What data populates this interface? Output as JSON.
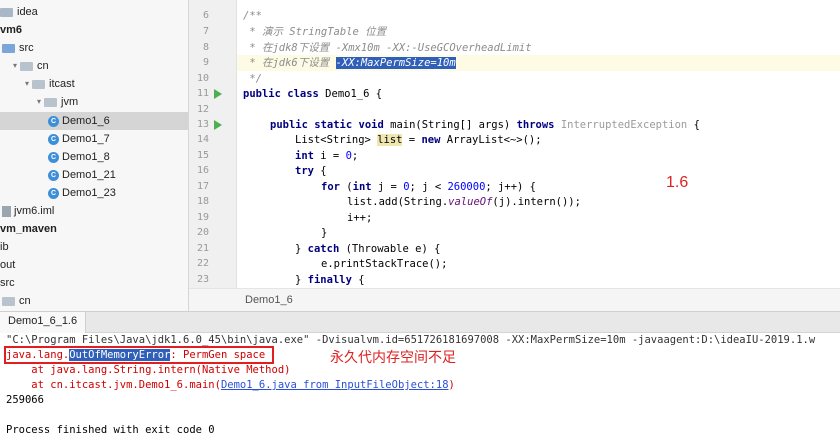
{
  "tree": [
    {
      "label": "idea",
      "arrow": "",
      "icon": "folder",
      "bold": false
    },
    {
      "label": "vm6",
      "arrow": "",
      "icon": "",
      "bold": true
    },
    {
      "label": "src",
      "arrow": "",
      "icon": "src",
      "bold": false
    },
    {
      "label": "cn",
      "arrow": "▾",
      "icon": "pkg",
      "bold": false
    },
    {
      "label": "itcast",
      "arrow": "▾",
      "icon": "pkg",
      "bold": false
    },
    {
      "label": "jvm",
      "arrow": "▾",
      "icon": "pkg",
      "bold": false
    },
    {
      "label": "Demo1_6",
      "arrow": "",
      "icon": "class",
      "bold": false,
      "selected": true
    },
    {
      "label": "Demo1_7",
      "arrow": "",
      "icon": "class",
      "bold": false
    },
    {
      "label": "Demo1_8",
      "arrow": "",
      "icon": "class",
      "bold": false
    },
    {
      "label": "Demo1_21",
      "arrow": "",
      "icon": "class",
      "bold": false
    },
    {
      "label": "Demo1_23",
      "arrow": "",
      "icon": "class",
      "bold": false
    },
    {
      "label": "jvm6.iml",
      "arrow": "",
      "icon": "file",
      "bold": false
    },
    {
      "label": "vm_maven",
      "arrow": "",
      "icon": "",
      "bold": true
    },
    {
      "label": "ib",
      "arrow": "",
      "icon": "",
      "bold": false
    },
    {
      "label": "out",
      "arrow": "",
      "icon": "",
      "bold": false
    },
    {
      "label": "src",
      "arrow": "",
      "icon": "",
      "bold": false
    },
    {
      "label": "cn",
      "arrow": "",
      "icon": "pkg",
      "bold": false
    }
  ],
  "line_numbers": [
    "6",
    "7",
    "8",
    "9",
    "10",
    "11",
    "12",
    "13",
    "14",
    "15",
    "16",
    "17",
    "18",
    "19",
    "20",
    "21",
    "22",
    "23"
  ],
  "run_markers": [
    "11",
    "13"
  ],
  "code": {
    "l6": "/**",
    "l7": " * 演示 StringTable 位置",
    "l8": " * 在jdk8下设置 -Xmx10m -XX:-UseGCOverheadLimit",
    "l9a": " * 在jdk6下设置 ",
    "l9b": "-XX:MaxPermSize=10m",
    "l10": " */",
    "l11kw": "public class",
    "l11": " Demo1_6 {",
    "l13kw": "public static void",
    "l13a": " main(String[] args) ",
    "l13kw2": "throws",
    "l13ex": " InterruptedException",
    "l13b": " {",
    "l14a": "List<String> ",
    "l14var": "list",
    "l14b": " = ",
    "l14kw": "new",
    "l14c": " ArrayList<~>();",
    "l15kw": "int",
    "l15a": " i = ",
    "l15num": "0",
    "l15b": ";",
    "l16kw": "try",
    "l16b": " {",
    "l17kw": "for",
    "l17a": " (",
    "l17kw2": "int",
    "l17b": " j = ",
    "l17num": "0",
    "l17c": "; j < ",
    "l17num2": "260000",
    "l17d": "; j++) {",
    "l18a": "list.add(String.",
    "l18fn": "valueOf",
    "l18b": "(j).intern());",
    "l19": "i++;",
    "l20": "}",
    "l21a": "} ",
    "l21kw": "catch",
    "l21b": " (Throwable e) {",
    "l22": "e.printStackTrace();",
    "l23a": "} ",
    "l23kw": "finally",
    "l23b": " {"
  },
  "annotation_version": "1.6",
  "editor_tab": "Demo1_6",
  "run_tab": "Demo1_6_1.6",
  "console": {
    "cmd": "\"C:\\Program Files\\Java\\jdk1.6.0_45\\bin\\java.exe\" -Dvisualvm.id=651726181697008 -XX:MaxPermSize=10m -javaagent:D:\\ideaIU-2019.1.w",
    "err_a": "java.lang.",
    "err_sel": "OutOfMemoryError",
    "err_b": ": PermGen space",
    "at1": "    at java.lang.String.intern(Native Method)",
    "at2a": "    at cn.itcast.jvm.Demo1_6.main(",
    "at2link": "Demo1_6.java from InputFileObject:18",
    "at2b": ")",
    "count": "259066",
    "exit": "Process finished with exit code 0"
  },
  "annotation_error": "永久代内存空间不足",
  "colors": {
    "keyword": "#000080",
    "comment": "#8c8c8c",
    "error": "#d00000",
    "selection": "#2f5fb8",
    "annotation": "#dd2222"
  }
}
